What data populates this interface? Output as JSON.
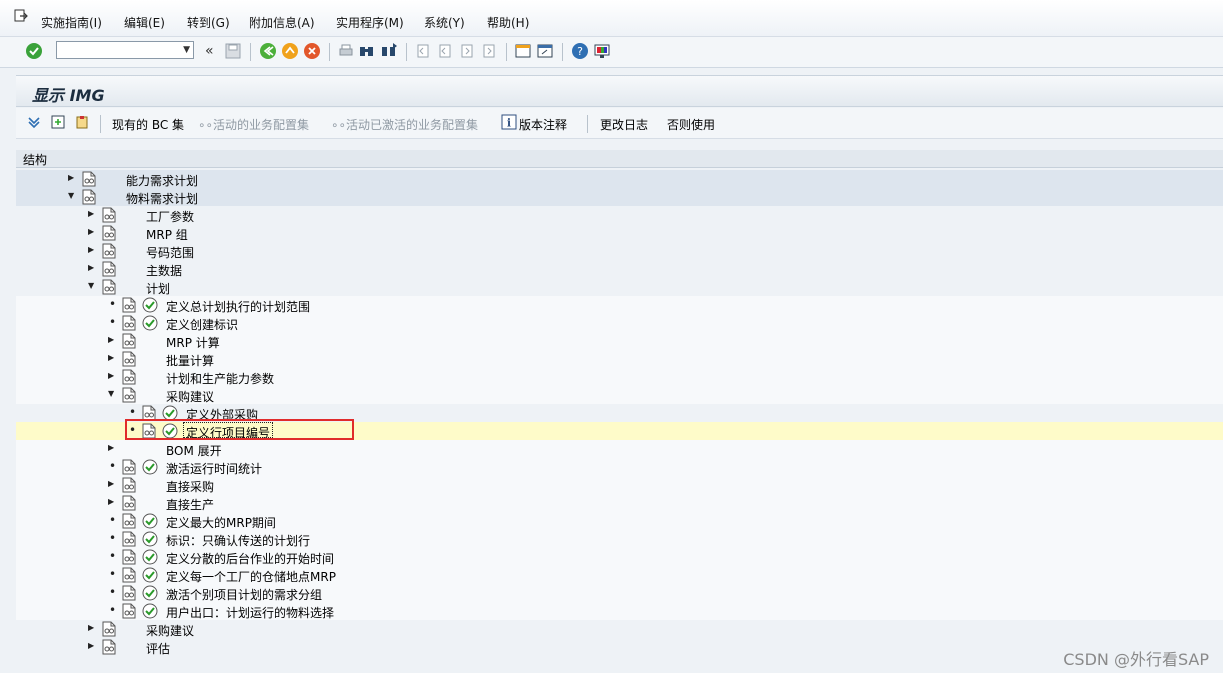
{
  "menu": {
    "items": [
      "实施指南(I)",
      "编辑(E)",
      "转到(G)",
      "附加信息(A)",
      "实用程序(M)",
      "系统(Y)",
      "帮助(H)"
    ]
  },
  "toolbar": {
    "command_value": "",
    "icons": [
      "enter-check-icon",
      "back-icon",
      "save-icon",
      "green-back-icon",
      "exit-icon",
      "cancel-icon",
      "print-icon",
      "find-icon",
      "find-next-icon",
      "first-page-icon",
      "prev-page-icon",
      "next-page-icon",
      "last-page-icon",
      "create-session-icon",
      "shortcut-icon",
      "help-icon",
      "layout-icon"
    ]
  },
  "title": "显示 IMG",
  "app_toolbar": {
    "current_bc_set": "现有的 BC 集",
    "activated_bc_sets": "活动的业务配置集",
    "bc_sets_to_activate": "活动已激活的业务配置集",
    "release_notes": "版本注释",
    "change_log": "更改日志",
    "where_used": "否则使用"
  },
  "tree": {
    "header": "结构",
    "rows": [
      {
        "label": "能力需求计划",
        "level": 1,
        "toggle": "collapsed",
        "activity": false,
        "style": "band"
      },
      {
        "label": "物料需求计划",
        "level": 1,
        "toggle": "expanded",
        "activity": false,
        "style": "band"
      },
      {
        "label": "工厂参数",
        "level": 2,
        "toggle": "collapsed",
        "activity": false,
        "style": "plain"
      },
      {
        "label": "MRP 组",
        "level": 2,
        "toggle": "collapsed",
        "activity": false,
        "style": "plain"
      },
      {
        "label": "号码范围",
        "level": 2,
        "toggle": "collapsed",
        "activity": false,
        "style": "plain"
      },
      {
        "label": "主数据",
        "level": 2,
        "toggle": "collapsed",
        "activity": false,
        "style": "plain"
      },
      {
        "label": "计划",
        "level": 2,
        "toggle": "expanded",
        "activity": false,
        "style": "plain"
      },
      {
        "label": "定义总计划执行的计划范围",
        "level": 3,
        "toggle": "leaf",
        "activity": true,
        "style": "white"
      },
      {
        "label": "定义创建标识",
        "level": 3,
        "toggle": "leaf",
        "activity": true,
        "style": "white"
      },
      {
        "label": "MRP 计算",
        "level": 3,
        "toggle": "collapsed",
        "activity": false,
        "style": "white"
      },
      {
        "label": "批量计算",
        "level": 3,
        "toggle": "collapsed",
        "activity": false,
        "style": "white"
      },
      {
        "label": "计划和生产能力参数",
        "level": 3,
        "toggle": "collapsed",
        "activity": false,
        "style": "white"
      },
      {
        "label": "采购建议",
        "level": 3,
        "toggle": "expanded",
        "activity": false,
        "style": "white"
      },
      {
        "label": "定义外部采购",
        "level": 4,
        "toggle": "leaf",
        "activity": true,
        "style": "plain"
      },
      {
        "label": "定义行项目编号",
        "level": 4,
        "toggle": "leaf",
        "activity": true,
        "style": "hl"
      },
      {
        "label": "BOM 展开",
        "level": 3,
        "toggle": "collapsed",
        "activity": false,
        "style": "white",
        "no_doc": true
      },
      {
        "label": "激活运行时间统计",
        "level": 3,
        "toggle": "leaf",
        "activity": true,
        "style": "white"
      },
      {
        "label": "直接采购",
        "level": 3,
        "toggle": "collapsed",
        "activity": false,
        "style": "white"
      },
      {
        "label": "直接生产",
        "level": 3,
        "toggle": "collapsed",
        "activity": false,
        "style": "white"
      },
      {
        "label": "定义最大的MRP期间",
        "level": 3,
        "toggle": "leaf",
        "activity": true,
        "style": "white"
      },
      {
        "label": "标识：只确认传送的计划行",
        "level": 3,
        "toggle": "leaf",
        "activity": true,
        "style": "white"
      },
      {
        "label": "定义分散的后台作业的开始时间",
        "level": 3,
        "toggle": "leaf",
        "activity": true,
        "style": "white"
      },
      {
        "label": "定义每一个工厂的仓储地点MRP",
        "level": 3,
        "toggle": "leaf",
        "activity": true,
        "style": "white"
      },
      {
        "label": "激活个别项目计划的需求分组",
        "level": 3,
        "toggle": "leaf",
        "activity": true,
        "style": "white"
      },
      {
        "label": "用户出口：计划运行的物料选择",
        "level": 3,
        "toggle": "leaf",
        "activity": true,
        "style": "white"
      },
      {
        "label": "采购建议",
        "level": 2,
        "toggle": "collapsed",
        "activity": false,
        "style": "plain"
      },
      {
        "label": "评估",
        "level": 2,
        "toggle": "collapsed",
        "activity": false,
        "style": "plain"
      }
    ]
  },
  "watermark": "CSDN @外行看SAP"
}
